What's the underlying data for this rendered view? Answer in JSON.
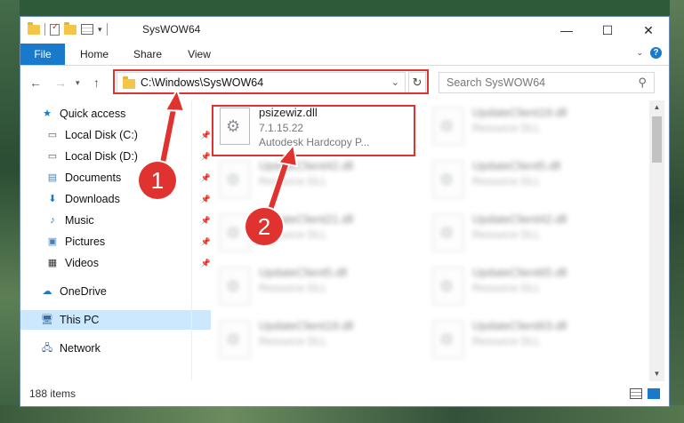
{
  "window": {
    "title": "SysWOW64",
    "controls": {
      "minimize": "—",
      "maximize": "☐",
      "close": "✕"
    }
  },
  "ribbon": {
    "tabs": [
      "File",
      "Home",
      "Share",
      "View"
    ],
    "expand_caret": "⌄",
    "help": "?"
  },
  "address_bar": {
    "path": "C:\\Windows\\SysWOW64",
    "search_placeholder": "Search SysWOW64"
  },
  "nav_pane": {
    "items": [
      {
        "label": "Quick access",
        "icon": "star-icon",
        "pinned": false
      },
      {
        "label": "Local Disk (C:)",
        "icon": "drive-icon",
        "pinned": true
      },
      {
        "label": "Local Disk (D:)",
        "icon": "drive-icon",
        "pinned": true
      },
      {
        "label": "Documents",
        "icon": "documents-icon",
        "pinned": true
      },
      {
        "label": "Downloads",
        "icon": "downloads-icon",
        "pinned": true
      },
      {
        "label": "Music",
        "icon": "music-icon",
        "pinned": true
      },
      {
        "label": "Pictures",
        "icon": "pictures-icon",
        "pinned": true
      },
      {
        "label": "Videos",
        "icon": "videos-icon",
        "pinned": true
      },
      {
        "label": "OneDrive",
        "icon": "onedrive-icon",
        "pinned": false
      },
      {
        "label": "This PC",
        "icon": "computer-icon",
        "pinned": false,
        "selected": true
      },
      {
        "label": "Network",
        "icon": "network-icon",
        "pinned": false
      }
    ]
  },
  "files": [
    {
      "name": "psizewiz.dll",
      "version": "7.1.15.22",
      "description": "Autodesk Hardcopy P...",
      "blurred": false
    },
    {
      "name": "UpdateClient19.dll",
      "description": "Resource DLL",
      "blurred": true
    },
    {
      "name": "UpdateClient42.dll",
      "description": "Resource DLL",
      "blurred": true
    },
    {
      "name": "UpdateClient5.dll",
      "description": "Resource DLL",
      "blurred": true
    },
    {
      "name": "UpdateClient21.dll",
      "description": "Resource DLL",
      "blurred": true
    },
    {
      "name": "UpdateClient42.dll",
      "description": "Resource DLL",
      "blurred": true
    },
    {
      "name": "UpdateClient5.dll",
      "description": "Resource DLL",
      "blurred": true
    },
    {
      "name": "UpdateClient65.dll",
      "description": "Resource DLL",
      "blurred": true
    },
    {
      "name": "UpdateClient19.dll",
      "description": "Resource DLL",
      "blurred": true
    },
    {
      "name": "UpdateClient63.dll",
      "description": "Resource DLL",
      "blurred": true
    }
  ],
  "status_bar": {
    "item_count": "188 items"
  },
  "annotations": {
    "step1": "1",
    "step2": "2",
    "color": "#e0322f"
  }
}
